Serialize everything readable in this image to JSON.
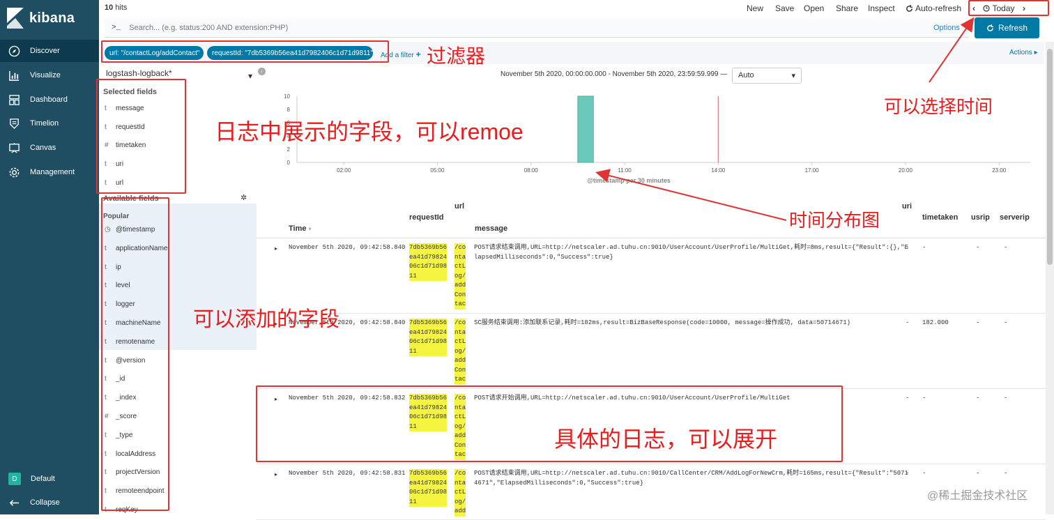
{
  "nav": {
    "brand": "kibana",
    "items": [
      {
        "label": "Discover",
        "icon": "compass-icon",
        "active": true
      },
      {
        "label": "Visualize",
        "icon": "bar-chart-icon"
      },
      {
        "label": "Dashboard",
        "icon": "dashboard-icon"
      },
      {
        "label": "Timelion",
        "icon": "shield-icon"
      },
      {
        "label": "Canvas",
        "icon": "canvas-icon"
      },
      {
        "label": "Management",
        "icon": "gear-icon"
      }
    ],
    "space_badge": "D",
    "space_label": "Default",
    "collapse_label": "Collapse"
  },
  "topbar": {
    "hits_count": "10",
    "hits_label": "hits",
    "menu": [
      "New",
      "Save",
      "Open",
      "Share",
      "Inspect"
    ],
    "auto_refresh": "Auto-refresh",
    "time_label": "Today"
  },
  "query": {
    "prompt": ">_",
    "placeholder": "Search... (e.g. status:200 AND extension:PHP)",
    "options_label": "Options",
    "refresh_label": "Refresh"
  },
  "filters": {
    "pills": [
      "url: \"/contactLog/addContact\"",
      "requestId: \"7db5369b56ea41d7982406c1d71d9811\""
    ],
    "add_filter": "Add a filter",
    "actions": "Actions"
  },
  "sidebar": {
    "index_pattern": "logstash-logback*",
    "selected_title": "Selected fields",
    "selected_fields": [
      {
        "type": "t",
        "name": "message"
      },
      {
        "type": "t",
        "name": "requestId"
      },
      {
        "type": "#",
        "name": "timetaken"
      },
      {
        "type": "t",
        "name": "uri"
      },
      {
        "type": "t",
        "name": "url"
      }
    ],
    "available_title": "Available fields",
    "popular_title": "Popular",
    "available_fields": [
      {
        "type": "◷",
        "name": "@timestamp"
      },
      {
        "type": "t",
        "name": "applicationName"
      },
      {
        "type": "t",
        "name": "ip"
      },
      {
        "type": "t",
        "name": "level"
      },
      {
        "type": "t",
        "name": "logger"
      },
      {
        "type": "t",
        "name": "machineName"
      },
      {
        "type": "t",
        "name": "remotename"
      },
      {
        "type": "t",
        "name": "@version"
      },
      {
        "type": "t",
        "name": "_id"
      },
      {
        "type": "t",
        "name": "_index"
      },
      {
        "type": "#",
        "name": "_score"
      },
      {
        "type": "t",
        "name": "_type"
      },
      {
        "type": "t",
        "name": "localAddress"
      },
      {
        "type": "t",
        "name": "projectVersion"
      },
      {
        "type": "t",
        "name": "remoteendpoint"
      },
      {
        "type": "t",
        "name": "reqKey"
      }
    ]
  },
  "histogram": {
    "range_text": "November 5th 2020, 00:00:00.000 - November 5th 2020, 23:59:59.999 —",
    "interval": "Auto",
    "xlabel": "@timestamp per 30 minutes",
    "colors": {
      "bar": "#6ac9bb",
      "marker": "#e07b7b"
    }
  },
  "chart_data": {
    "type": "bar",
    "y_ticks": [
      0,
      2,
      4,
      6,
      8,
      10
    ],
    "ylim": [
      0,
      10
    ],
    "x_ticks": [
      "02:00",
      "05:00",
      "08:00",
      "11:00",
      "14:00",
      "17:00",
      "20:00",
      "23:00"
    ],
    "series": [
      {
        "x_start": "09:30",
        "x_end": "10:00",
        "value": 10
      }
    ],
    "current_time_marker": "14:00",
    "xlabel": "@timestamp per 30 minutes"
  },
  "table": {
    "headers": {
      "time": "Time",
      "requestId": "requestId",
      "url": "url",
      "message": "message",
      "uri": "uri",
      "timetaken": "timetaken",
      "usrip": "usrip",
      "serverip": "serverip"
    },
    "rows": [
      {
        "time": "November 5th 2020, 09:42:58.840",
        "requestId": "7db5369b56\nea41d79824\n06c1d71d98\n11",
        "url": "/co\nnta\nctL\nog/\nadd\nCon\ntac",
        "message": "POST请求结束调用,URL=http://netscaler.ad.tuhu.cn:9010/UserAccount/UserProfile/MultiGet,耗时=8ms,result={\"Result\":{},\"E\nlapsedMilliseconds\":0,\"Success\":true}",
        "uri": "-",
        "timetaken": "-",
        "usrip": "-",
        "serverip": "-"
      },
      {
        "time": "November 5th 2020, 09:42:58.840",
        "requestId": "7db5369b56\nea41d79824\n06c1d71d98\n11",
        "url": "/co\nnta\nctL\nog/\nadd\nCon\ntac",
        "message": "SC服务结束调用:添加联系记录,耗时=182ms,result=BizBaseResponse(code=10000, message=操作成功, data=50714671)",
        "uri": "-",
        "timetaken": "182.000",
        "usrip": "-",
        "serverip": "-"
      },
      {
        "time": "November 5th 2020, 09:42:58.832",
        "requestId": "7db5369b56\nea41d79824\n06c1d71d98\n11",
        "url": "/co\nnta\nctL\nog/\nadd\nCon\ntac",
        "message": "POST请求开始调用,URL=http://netscaler.ad.tuhu.cn:9010/UserAccount/UserProfile/MultiGet",
        "uri": "-",
        "timetaken": "-",
        "usrip": "-",
        "serverip": "-"
      },
      {
        "time": "November 5th 2020, 09:42:58.831",
        "requestId": "7db5369b56\nea41d79824\n06c1d71d98\n11",
        "url": "/co\nnta\nctL\nog/\nadd",
        "message": "POST请求结束调用,URL=http://netscaler.ad.tuhu.cn:9010/CallCenter/CRM/AddLogForNewCrm,耗时=165ms,result={\"Result\":\"5071\n4671\",\"ElapsedMilliseconds\":0,\"Success\":true}",
        "uri": "-",
        "timetaken": "-",
        "usrip": "-",
        "serverip": "-"
      }
    ]
  },
  "annotations": {
    "filter": "过滤器",
    "time_select": "可以选择时间",
    "selected_fields": "日志中展示的字段，可以remoe",
    "histogram": "时间分布图",
    "available_fields": "可以添加的字段",
    "log_row": "具体的日志，可以展开",
    "color": "#e03434"
  },
  "watermark": "@稀土掘金技术社区"
}
